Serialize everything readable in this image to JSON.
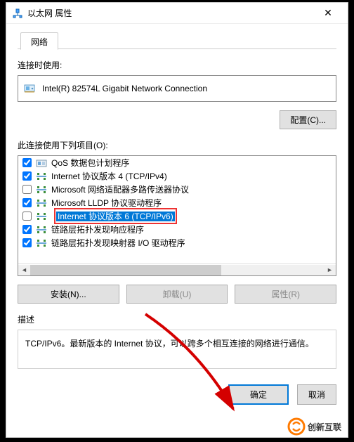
{
  "window": {
    "title": "以太网 属性",
    "close_glyph": "✕"
  },
  "tab": {
    "label": "网络"
  },
  "connect_using": {
    "label": "连接时使用:",
    "adapter": "Intel(R) 82574L Gigabit Network Connection",
    "configure_btn": "配置(C)..."
  },
  "items_label": "此连接使用下列项目(O):",
  "items": [
    {
      "checked": true,
      "label": "QoS 数据包计划程序"
    },
    {
      "checked": true,
      "label": "Internet 协议版本 4 (TCP/IPv4)"
    },
    {
      "checked": false,
      "label": "Microsoft 网络适配器多路传送器协议"
    },
    {
      "checked": true,
      "label": "Microsoft LLDP 协议驱动程序"
    },
    {
      "checked": false,
      "label": "Internet 协议版本 6 (TCP/IPv6)",
      "highlighted": true
    },
    {
      "checked": true,
      "label": "链路层拓扑发现响应程序"
    },
    {
      "checked": true,
      "label": "链路层拓扑发现映射器 I/O 驱动程序"
    }
  ],
  "buttons": {
    "install": "安装(N)...",
    "uninstall": "卸载(U)",
    "properties": "属性(R)"
  },
  "description": {
    "group_label": "描述",
    "text": "TCP/IPv6。最新版本的 Internet 协议，可以跨多个相互连接的网络进行通信。"
  },
  "footer": {
    "ok": "确定",
    "cancel": "取消"
  },
  "watermark": "创新互联"
}
